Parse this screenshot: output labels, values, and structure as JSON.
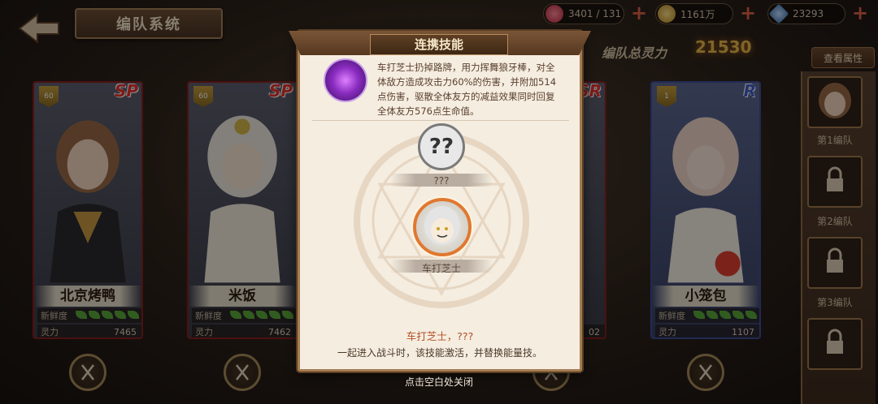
{
  "header": {
    "back_label": "",
    "title": "编队系统"
  },
  "resources": {
    "stamina": "3401 / 131",
    "gold": "1161万",
    "gems": "23293"
  },
  "team_power": {
    "label": "编队总灵力",
    "value": "21530"
  },
  "attr_button": "查看属性",
  "cards": [
    {
      "name": "北京烤鸭",
      "rarity": "SP",
      "level": "60",
      "freshness_label": "新鲜度",
      "power_label": "灵力",
      "power": "7465"
    },
    {
      "name": "米饭",
      "rarity": "SP",
      "level": "60",
      "freshness_label": "新鲜度",
      "power_label": "灵力",
      "power": "7462"
    },
    {
      "name": "",
      "rarity": "SR",
      "level": "",
      "freshness_label": "",
      "power_label": "",
      "power": "02"
    },
    {
      "name": "小笼包",
      "rarity": "R",
      "level": "1",
      "freshness_label": "新鲜度",
      "power_label": "灵力",
      "power": "1107"
    }
  ],
  "teams": {
    "team1": "第1编队",
    "team2": "第2编队",
    "team3": "第3编队"
  },
  "modal": {
    "title": "连携技能",
    "description": "车打芝士扔掉路牌，用力挥舞狼牙棒，对全体敌方造成攻击力60%的伤害，并附加514点伤害，驱散全体友方的减益效果同时回复全体友方576点生命值。",
    "unknown_char_symbol": "??",
    "unknown_char_name": "???",
    "known_char_name": "车打芝士",
    "combo": "车打芝士，???",
    "combo_desc": "一起进入战斗时，该技能激活，并替换能量技。"
  },
  "close_hint": "点击空白处关闭",
  "colors": {
    "accent_gold": "#e8b84a",
    "sp_red": "#e8302a",
    "r_blue": "#3e5cc8",
    "modal_bg": "#f5ede0",
    "combo_text": "#b05024"
  }
}
